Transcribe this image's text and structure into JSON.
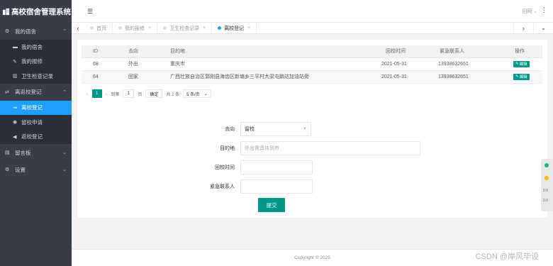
{
  "app": {
    "title": "高校宿舍管理系统"
  },
  "sidebar": {
    "groups": [
      {
        "label": "我的宿舍",
        "icon": "gear-icon",
        "items": [
          {
            "label": "我的宿舍",
            "icon": "bed-icon"
          },
          {
            "label": "我的报修",
            "icon": "wrench-icon"
          },
          {
            "label": "卫生检查记录",
            "icon": "chart-icon"
          }
        ]
      },
      {
        "label": "离返校登记",
        "icon": "swap-icon",
        "items": [
          {
            "label": "离校登记",
            "icon": "exit-icon"
          },
          {
            "label": "留校申请",
            "icon": "globe-icon"
          },
          {
            "label": "返校登记",
            "icon": "volume-icon"
          }
        ]
      },
      {
        "label": "留言板",
        "icon": "note-icon"
      },
      {
        "label": "设置",
        "icon": "gear-icon"
      }
    ],
    "active_item": "离校登记"
  },
  "header": {
    "user": "旧网",
    "menu_icon": "menu-icon",
    "more_icon": "more-icon"
  },
  "tabs": [
    {
      "label": "首页",
      "closable": false,
      "active": false
    },
    {
      "label": "我的报修",
      "closable": true,
      "active": false
    },
    {
      "label": "卫生检查记录",
      "closable": true,
      "active": false
    },
    {
      "label": "离校登记",
      "closable": true,
      "active": true
    }
  ],
  "table": {
    "columns": [
      "ID",
      "去向",
      "目的地",
      "回校时间",
      "紧急联系人",
      "操作"
    ],
    "rows": [
      {
        "id": "68",
        "direction": "外出",
        "destination": "重庆市",
        "return_time": "2021-05-31",
        "contact": "13938632651",
        "action": "编辑"
      },
      {
        "id": "64",
        "direction": "回家",
        "destination": "广西壮族自治区郭刚县海齿区新塘乡三平村大梁屯鹏达加油站旁",
        "return_time": "2021-05-31",
        "contact": "13938632651",
        "action": "编辑"
      }
    ]
  },
  "pager": {
    "current": "1",
    "goto_label": "到第",
    "goto_value": "1",
    "page_unit": "页",
    "confirm": "确定",
    "total": "共 2 条",
    "size": "5 条/页"
  },
  "form": {
    "direction_label": "去向",
    "direction_value": "留校",
    "destination_label": "目的地",
    "destination_placeholder": "外出需具体到市",
    "return_label": "回校时间",
    "contact_label": "紧急联系人",
    "submit": "提交"
  },
  "footer": {
    "copyright": "Copyright © 2025"
  },
  "watermark": "CSDN @岸风毕设",
  "float": {
    "t1": "0.0",
    "t2": "0.0"
  },
  "colors": {
    "accent": "#009688",
    "active_blue": "#1e9fff",
    "sidebar_bg": "#393d49"
  }
}
